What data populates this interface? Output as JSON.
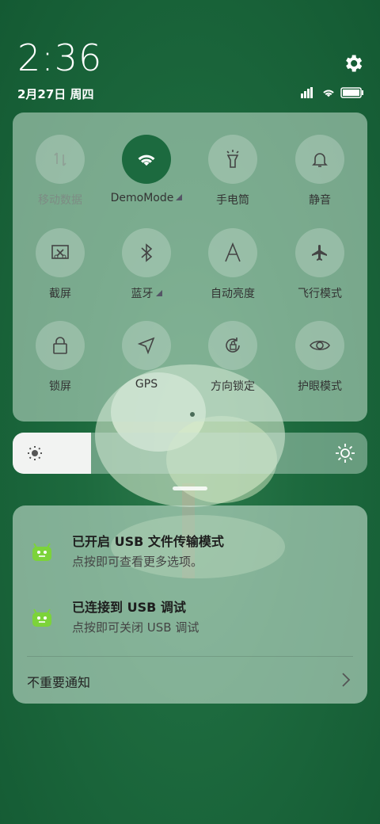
{
  "status": {
    "time": "2:36",
    "date": "2月27日 周四"
  },
  "quick_settings": {
    "tiles": [
      {
        "label": "移动数据",
        "icon": "mobile-data-icon",
        "active": false,
        "disabled": true
      },
      {
        "label": "DemoMode",
        "icon": "wifi-icon",
        "active": true,
        "expandable": true
      },
      {
        "label": "手电筒",
        "icon": "flashlight-icon",
        "active": false
      },
      {
        "label": "静音",
        "icon": "bell-icon",
        "active": false
      },
      {
        "label": "截屏",
        "icon": "screenshot-icon",
        "active": false
      },
      {
        "label": "蓝牙",
        "icon": "bluetooth-icon",
        "active": false,
        "expandable": true
      },
      {
        "label": "自动亮度",
        "icon": "auto-brightness-icon",
        "active": false
      },
      {
        "label": "飞行模式",
        "icon": "airplane-icon",
        "active": false
      },
      {
        "label": "锁屏",
        "icon": "lock-icon",
        "active": false
      },
      {
        "label": "GPS",
        "icon": "gps-icon",
        "active": false
      },
      {
        "label": "方向锁定",
        "icon": "rotation-lock-icon",
        "active": false
      },
      {
        "label": "护眼模式",
        "icon": "eye-icon",
        "active": false
      }
    ],
    "page_index": 1,
    "page_count": 1
  },
  "brightness": {
    "level": 0.22
  },
  "notifications": {
    "items": [
      {
        "title": "已开启 USB 文件传输模式",
        "subtitle": "点按即可查看更多选项。",
        "icon": "android-usb-icon"
      },
      {
        "title": "已连接到 USB 调试",
        "subtitle": "点按即可关闭 USB 调试",
        "icon": "android-usb-icon"
      }
    ],
    "footer": "不重要通知"
  },
  "colors": {
    "background": "#1d6a3e",
    "active_tile": "#1c6a3f",
    "android_green": "#7cd33a"
  }
}
